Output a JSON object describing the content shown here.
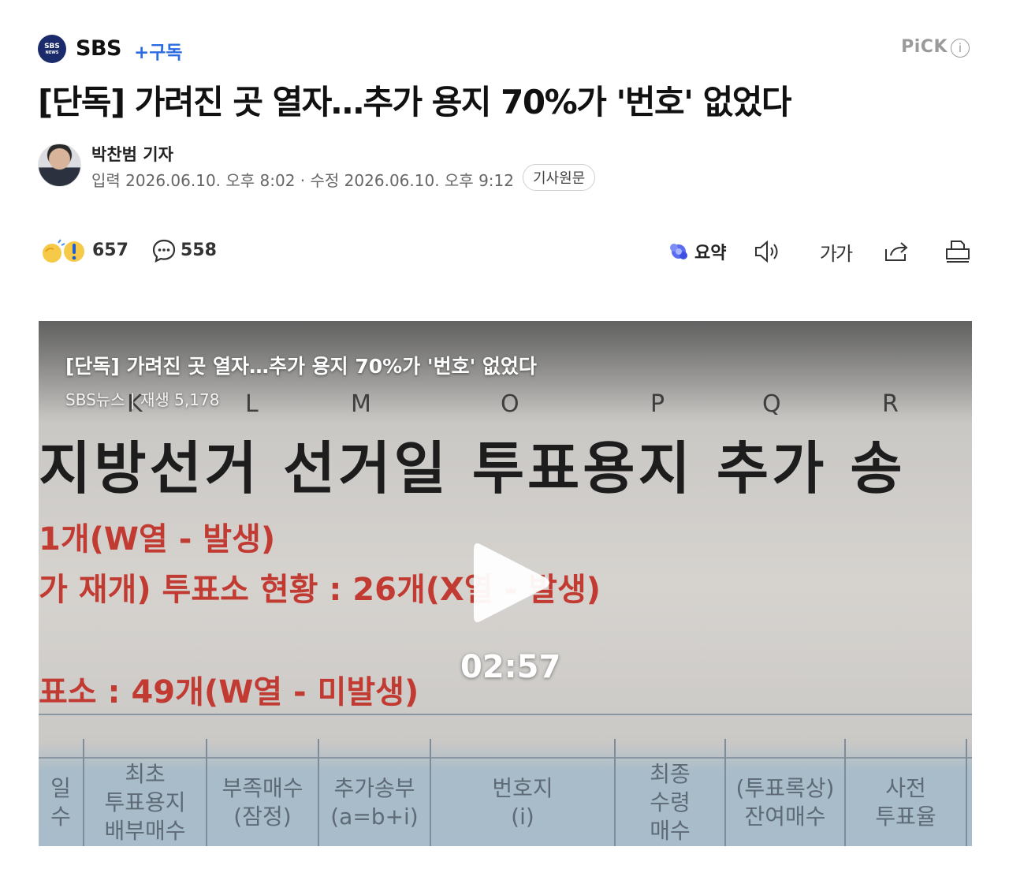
{
  "press": {
    "logo_text": "SBS",
    "logo_subtext": "NEWS",
    "name": "SBS",
    "subscribe_label": "+구독",
    "pick_label": "PiCK",
    "info_icon": "i"
  },
  "article": {
    "title": "[단독] 가려진 곳 열자…추가 용지 70%가 '번호' 없었다",
    "reporter": "박찬범 기자",
    "dates": "입력 2026.06.10. 오후 8:02 · 수정 2026.06.10. 오후 9:12",
    "origin_label": "기사원문"
  },
  "reactions": {
    "reaction_count": "657",
    "comment_count": "558",
    "summary_label": "요약",
    "font_size_label": "가가"
  },
  "video": {
    "title": "[단독] 가려진 곳 열자…추가 용지 70%가 '번호' 없었다",
    "meta": "SBS뉴스 | 재생 5,178",
    "duration": "02:57",
    "column_letters": [
      "K",
      "L",
      "M",
      "O",
      "P",
      "Q",
      "R"
    ],
    "heading": "지방선거 선거일 투표용지 추가 송",
    "red_lines": [
      "1개(W열 - 발생)",
      "가 재개) 투표소 현황 : 26개(X열 - 발생)",
      "표소 : 49개(W열 - 미발생)"
    ],
    "table_headers": [
      "일\n수",
      "최초\n투표용지\n배부매수",
      "부족매수\n(잠정)",
      "추가송부\n(a=b+i)",
      "번호지\n(i)",
      "최종\n수령\n매수",
      "(투표록상)\n잔여매수",
      "사전\n투표율"
    ]
  },
  "colors": {
    "accent_blue": "#2d6be0",
    "press_navy": "#1b2a6b",
    "red_text": "#c23b32"
  }
}
